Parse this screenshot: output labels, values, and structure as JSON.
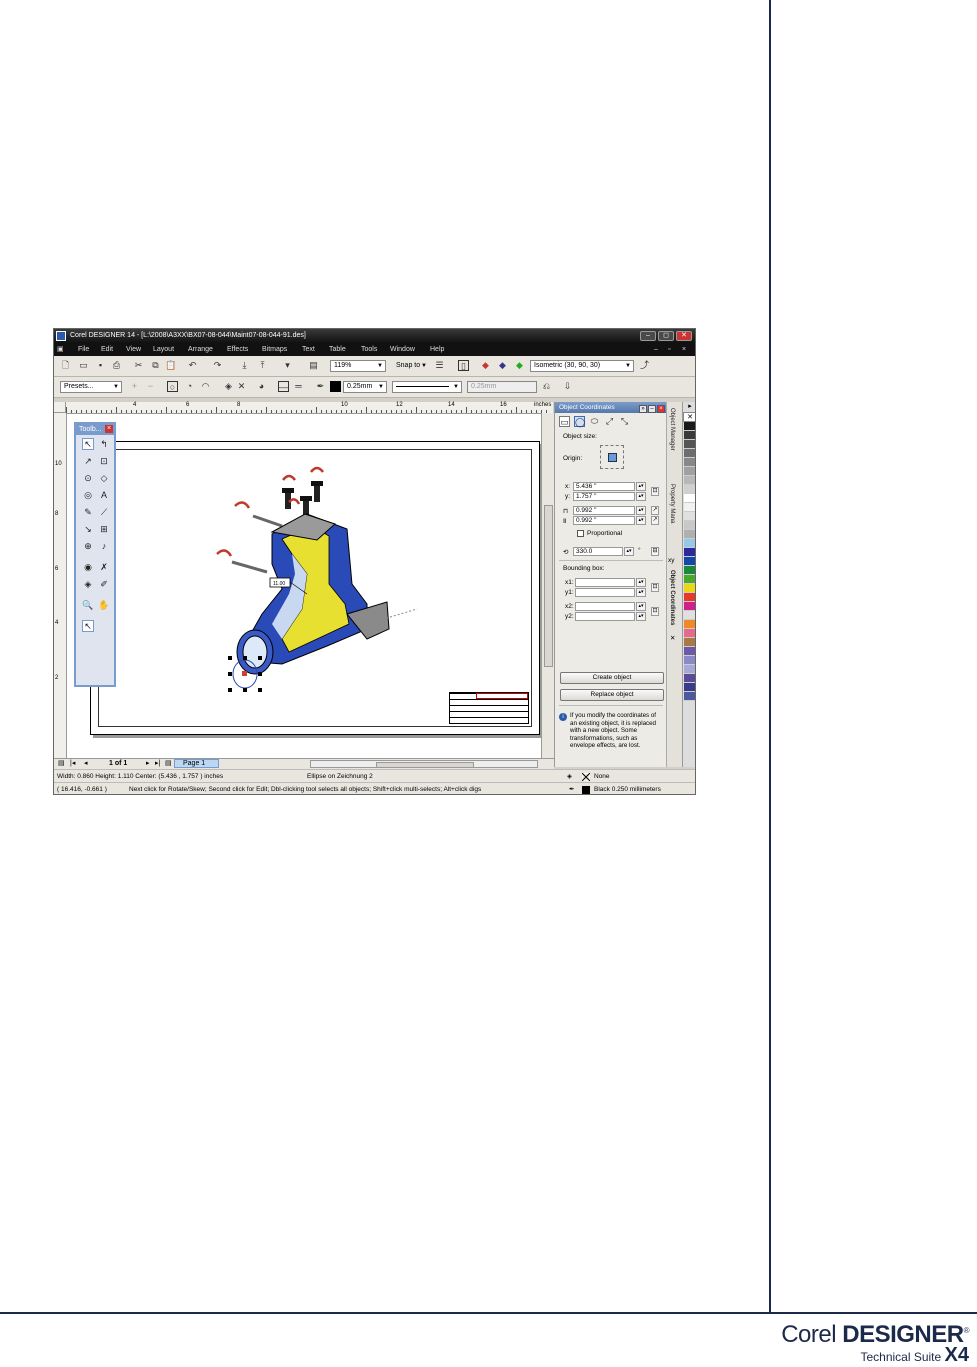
{
  "app": {
    "title": "Corel DESIGNER 14 - [L:\\2008\\A3XX\\BX07-08-044\\Maint07-08-044-91.des]",
    "menu": [
      "File",
      "Edit",
      "View",
      "Layout",
      "Arrange",
      "Effects",
      "Bitmaps",
      "Text",
      "Table",
      "Tools",
      "Window",
      "Help"
    ],
    "toolbar": {
      "zoom": "119%",
      "snap": "Snap to",
      "projection": "Isometric (30, 90, 30)"
    },
    "propertybar": {
      "presets": "Presets...",
      "outline_width": "0.25mm",
      "outline_width_disabled": "0.25mm"
    },
    "ruler": {
      "unit": "inches",
      "h_numbers": [
        "4",
        "6",
        "8",
        "10",
        "12",
        "14",
        "16"
      ],
      "v_numbers": [
        "10",
        "8",
        "6",
        "4",
        "2"
      ]
    },
    "callout": "11.00",
    "toolbox": {
      "title": "Toolb..."
    },
    "page_nav": {
      "count": "1 of 1",
      "tab": "Page 1"
    },
    "docker": {
      "title": "Object Coordinates",
      "object_size": "Object size:",
      "origin": "Origin:",
      "x_label": "x:",
      "x": "5.436 \"",
      "y_label": "y:",
      "y": "1.757 \"",
      "w": "0.992 \"",
      "h": "0.992 \"",
      "proportional": "Proportional",
      "angle": "330.0",
      "angle_unit": "°",
      "bounding_box": "Bounding box:",
      "bx1": "x1:",
      "by1": "y1:",
      "bx2": "x2:",
      "by2": "y2:",
      "create": "Create object",
      "replace": "Replace object",
      "info": "If you modify the coordinates of an existing object, it is replaced with a new object. Some transformations, such as envelope effects, are lost."
    },
    "side_tabs": [
      "Object Manager",
      "Property Mana",
      "Object Coordinates"
    ],
    "side_glyphs": {
      "xy": "xy",
      "close": "✕"
    },
    "status": {
      "size": "Width: 0.860  Height: 1.110  Center: (5.436 , 1.757 )  inches",
      "object": "Ellipse on Zeichnung 2",
      "fill": "None",
      "cursor": "( 16.416, -0.661 )",
      "hint": "Next click for Rotate/Skew; Second click for Edit; Dbl-clicking tool selects all objects; Shift+click multi-selects; Alt+click digs",
      "outline": "Black  0.250 millimeters"
    },
    "palette": [
      "#1a1a1a",
      "#3a3a3a",
      "#555555",
      "#6e6e6e",
      "#888888",
      "#a0a0a0",
      "#b8b8b8",
      "#d0d0d0",
      "#ffffff",
      "#f2f2f2",
      "#e0e0e0",
      "#c8c8c8",
      "#b0b0b0",
      "#98c8e8",
      "#2a2a9a",
      "#1448a8",
      "#1a8a3a",
      "#4aa82a",
      "#e8d818",
      "#e83828",
      "#d0208a",
      "#e0e0e0",
      "#f08a28",
      "#e86a8a",
      "#a87a48",
      "#6a5aa8",
      "#8a8ac8",
      "#a8a8d8",
      "#5a4a98",
      "#3a3a8a",
      "#4a5a9a"
    ]
  },
  "brand": {
    "corel": "Corel ",
    "designer": "DESIGNER",
    "reg": "®",
    "suite": "Technical Suite",
    "version": "X4"
  }
}
